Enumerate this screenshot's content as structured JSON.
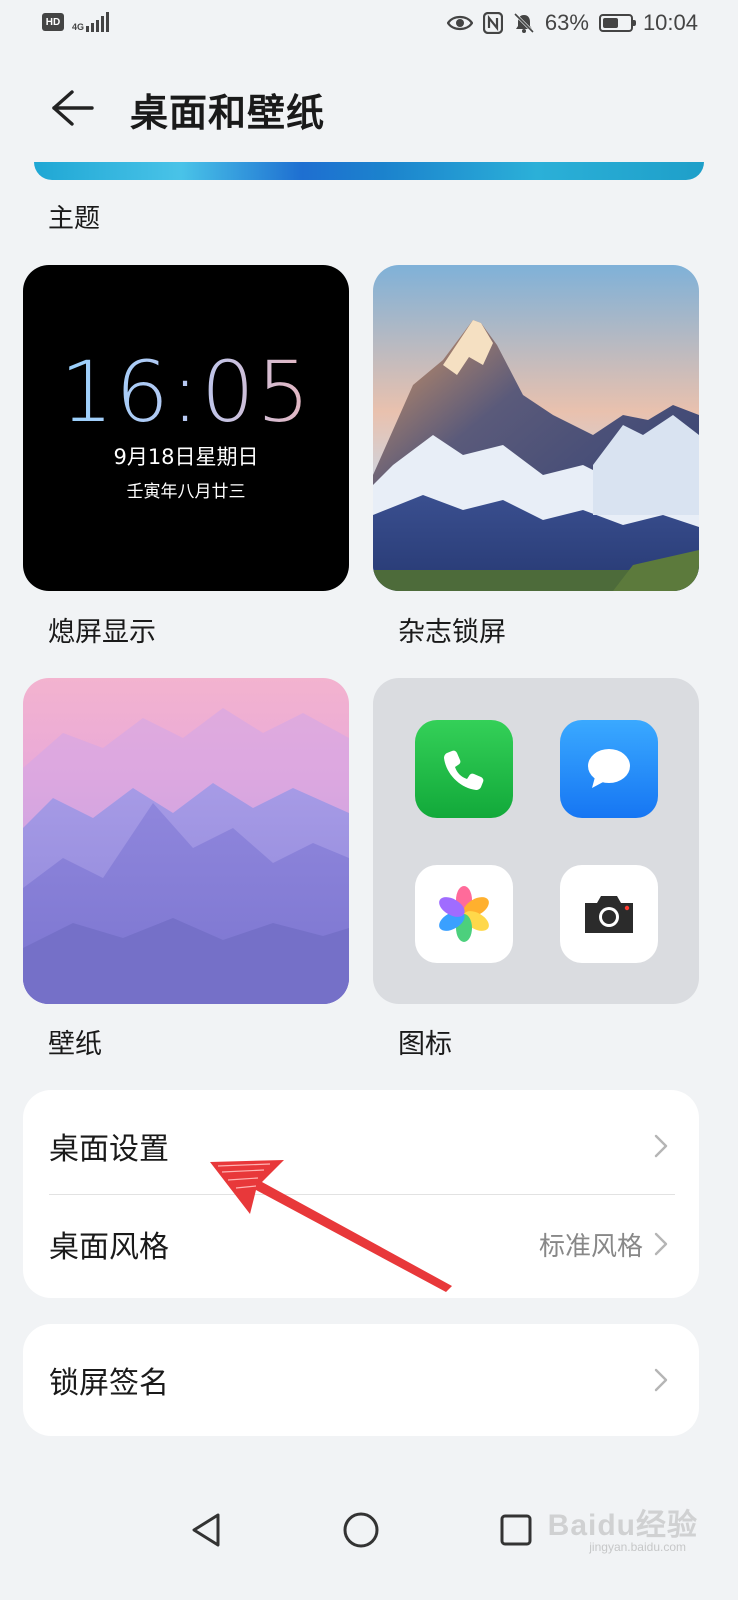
{
  "status_bar": {
    "hd": "HD",
    "network": "4G",
    "battery": "63%",
    "battery_level": 0.63,
    "time": "10:04"
  },
  "header": {
    "title": "桌面和壁纸"
  },
  "themes": {
    "section_label": "主题",
    "aod": {
      "time": "16:05",
      "date": "9月18日星期日",
      "lunar": "壬寅年八月廿三",
      "label": "熄屏显示"
    },
    "magazine": {
      "label": "杂志锁屏"
    },
    "wallpaper": {
      "label": "壁纸"
    },
    "icons": {
      "label": "图标"
    }
  },
  "settings_card": {
    "desktop_settings": {
      "label": "桌面设置"
    },
    "desktop_style": {
      "label": "桌面风格",
      "value": "标准风格"
    }
  },
  "lockscreen_card": {
    "signature": {
      "label": "锁屏签名"
    }
  },
  "watermark": {
    "text": "Baidu经验",
    "sub": "jingyan.baidu.com"
  },
  "colors": {
    "background": "#f1f3f5",
    "card": "#ffffff",
    "annotation_arrow": "#e8383a",
    "phone_icon": "#1fc24a",
    "message_icon": "#1e90ff"
  }
}
